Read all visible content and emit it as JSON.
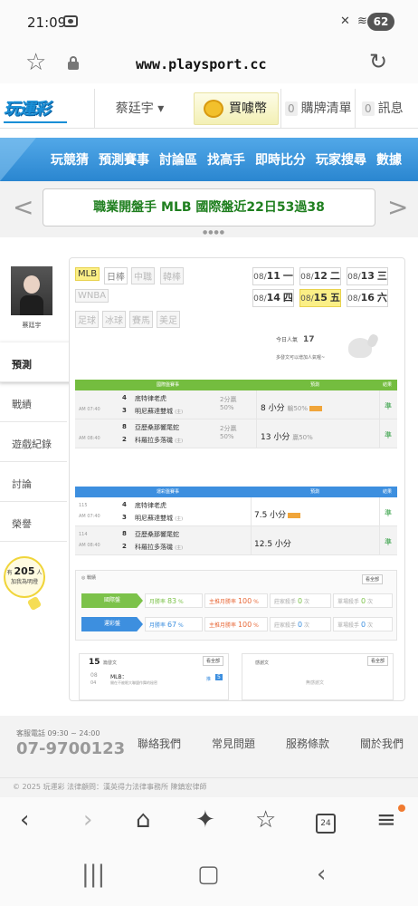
{
  "status_bar": {
    "time": "21:09",
    "battery": "62"
  },
  "browser": {
    "url": "www.playsport.cc"
  },
  "site_header": {
    "logo": "玩運彩",
    "user": "蔡廷宇 ▾",
    "buy_coins": "買噱幣",
    "cart_count": "0",
    "cart_label": "購牌清單",
    "msg_count": "0",
    "msg_label": "訊息"
  },
  "nav": {
    "items": [
      "玩競猜",
      "預測賽事",
      "討論區",
      "找高手",
      "即時比分",
      "玩家搜尋",
      "數據"
    ]
  },
  "banner": {
    "text": "職業開盤手 MLB 國際盤近22日53過38"
  },
  "sidebar": {
    "username": "蔡廷宇",
    "items": [
      "預測",
      "戰績",
      "遊戲紀錄",
      "討論",
      "榮譽"
    ],
    "fans_count": "205",
    "fans_prefix": "有",
    "fans_suffix": "人",
    "fans_note": "加我為明燈"
  },
  "league_tags": {
    "row1": [
      "MLB",
      "日棒",
      "中職",
      "韓棒"
    ],
    "row2": [
      "WNBA"
    ],
    "row3": [
      "足球",
      "冰球",
      "賽馬",
      "美足"
    ]
  },
  "dates": [
    {
      "md": "08/",
      "d": "11",
      "w": "一"
    },
    {
      "md": "08/",
      "d": "12",
      "w": "二"
    },
    {
      "md": "08/",
      "d": "13",
      "w": "三"
    },
    {
      "md": "08/",
      "d": "14",
      "w": "四"
    },
    {
      "md": "08/",
      "d": "15",
      "w": "五"
    },
    {
      "md": "08/",
      "d": "16",
      "w": "六"
    }
  ],
  "today": {
    "label": "今日人氣",
    "count": "17",
    "note": "多發文可以增加人氣喔~"
  },
  "intl_table": {
    "header": [
      "國際盤賽事",
      "預測",
      "結果"
    ],
    "rows": [
      {
        "time": "AM 07:40",
        "n1": "4",
        "team1": "底特律老虎",
        "n2": "3",
        "team2": "明尼蘇達雙城",
        "mark": "(主)",
        "odds1": "2分贏",
        "odds2": "50%",
        "pick": "8 小分",
        "pick_extra": "輸50%",
        "result": "準"
      },
      {
        "time": "AM 08:40",
        "n1": "8",
        "team1": "亞歷桑那響尾蛇",
        "n2": "2",
        "team2": "科羅拉多落磯",
        "mark": "(主)",
        "odds1": "2分贏",
        "odds2": "50%",
        "pick": "13 小分",
        "pick_extra": "贏50%",
        "result": "準"
      }
    ]
  },
  "lottery_table": {
    "header": [
      "運彩盤賽事",
      "預測",
      "結果"
    ],
    "rows": [
      {
        "idx": "115",
        "time": "AM 07:40",
        "n1": "4",
        "team1": "底特律老虎",
        "n2": "3",
        "team2": "明尼蘇達雙城",
        "mark": "(主)",
        "pick": "7.5 小分",
        "result": "準"
      },
      {
        "idx": "114",
        "time": "AM 08:40",
        "n1": "8",
        "team1": "亞歷桑那響尾蛇",
        "n2": "2",
        "team2": "科羅拉多落磯",
        "mark": "(主)",
        "pick": "12.5 小分",
        "result": "準"
      }
    ]
  },
  "stats": {
    "title": "戰績",
    "see_all": "看全部",
    "rows": [
      {
        "label": "國際盤",
        "month": "月勝率",
        "month_v": "83",
        "main": "主推月勝率",
        "main_v": "100",
        "kill": "莊家殺手",
        "kill_v": "0",
        "single": "單場殺手",
        "single_v": "0",
        "color": "#7cc24a"
      },
      {
        "label": "運彩盤",
        "month": "月勝率",
        "month_v": "67",
        "main": "主推月勝率",
        "main_v": "100",
        "kill": "莊家殺手",
        "kill_v": "0",
        "single": "單場殺手",
        "single_v": "0",
        "color": "#3d8fdf"
      }
    ],
    "pct": "%",
    "times": "次"
  },
  "posts": {
    "count": "15",
    "label": "篇發文",
    "see_all": "看全部",
    "item_date1": "08",
    "item_date2": "04",
    "item_title": "MLB：",
    "item_sub": "開在不被眼大聯盟作舞的秘密",
    "item_tag": "推",
    "item_num": "5"
  },
  "replies": {
    "label": "感謝文",
    "see_all": "看全部",
    "empty": "無感謝文"
  },
  "footer": {
    "hotline": "客服電話 09:30 ~ 24:00",
    "phone": "07-9700123",
    "links": [
      "聯絡我們",
      "常見問題",
      "服務條款",
      "關於我們"
    ],
    "copyright": "© 2025 玩運彩 法律顧問：漢英得力法律事務所 陳鎮宏律師"
  },
  "browser_nav": {
    "tabs_count": "24"
  }
}
